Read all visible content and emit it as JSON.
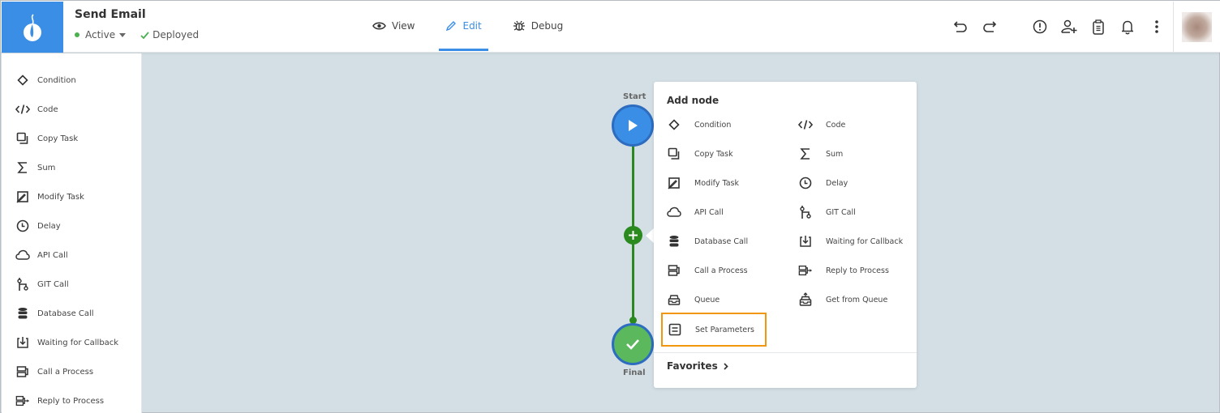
{
  "header": {
    "title": "Send Email",
    "status": "Active",
    "deploy_status": "Deployed",
    "colors": {
      "brand": "#3a8ee6",
      "active_dot": "#4caf50",
      "deployed_check": "#4caf50"
    }
  },
  "tabs": [
    {
      "label": "View",
      "icon": "eye-icon",
      "active": false
    },
    {
      "label": "Edit",
      "icon": "pencil-icon",
      "active": true
    },
    {
      "label": "Debug",
      "icon": "bug-icon",
      "active": false
    }
  ],
  "actions": [
    {
      "name": "undo",
      "icon": "undo-icon"
    },
    {
      "name": "redo",
      "icon": "redo-icon"
    },
    {
      "name": "alert",
      "icon": "alert-circle-icon"
    },
    {
      "name": "add-user",
      "icon": "user-plus-icon"
    },
    {
      "name": "clipboard",
      "icon": "clipboard-icon"
    },
    {
      "name": "notifications",
      "icon": "bell-icon"
    },
    {
      "name": "more",
      "icon": "more-vertical-icon"
    }
  ],
  "sidebar": {
    "items": [
      {
        "label": "Condition",
        "icon": "diamond-icon"
      },
      {
        "label": "Code",
        "icon": "code-icon"
      },
      {
        "label": "Copy Task",
        "icon": "copy-icon"
      },
      {
        "label": "Sum",
        "icon": "sigma-icon"
      },
      {
        "label": "Modify Task",
        "icon": "edit-box-icon"
      },
      {
        "label": "Delay",
        "icon": "clock-icon"
      },
      {
        "label": "API Call",
        "icon": "cloud-icon"
      },
      {
        "label": "GIT Call",
        "icon": "git-icon"
      },
      {
        "label": "Database Call",
        "icon": "database-icon"
      },
      {
        "label": "Waiting for Callback",
        "icon": "download-box-icon"
      },
      {
        "label": "Call a Process",
        "icon": "process-icon"
      },
      {
        "label": "Reply to Process",
        "icon": "reply-process-icon"
      }
    ]
  },
  "flow": {
    "start_label": "Start",
    "final_label": "Final",
    "colors": {
      "start": "#3a8ee6",
      "final": "#5cb85c",
      "line": "#2a8a1e"
    }
  },
  "popup": {
    "title": "Add node",
    "left_items": [
      {
        "label": "Condition",
        "icon": "diamond-icon"
      },
      {
        "label": "Copy Task",
        "icon": "copy-icon"
      },
      {
        "label": "Modify Task",
        "icon": "edit-box-icon"
      },
      {
        "label": "API Call",
        "icon": "cloud-icon"
      },
      {
        "label": "Database Call",
        "icon": "database-icon"
      },
      {
        "label": "Call a Process",
        "icon": "process-icon"
      },
      {
        "label": "Queue",
        "icon": "inbox-icon"
      },
      {
        "label": "Set Parameters",
        "icon": "list-box-icon",
        "highlighted": true
      }
    ],
    "right_items": [
      {
        "label": "Code",
        "icon": "code-icon"
      },
      {
        "label": "Sum",
        "icon": "sigma-icon"
      },
      {
        "label": "Delay",
        "icon": "clock-icon"
      },
      {
        "label": "GIT Call",
        "icon": "git-icon"
      },
      {
        "label": "Waiting for Callback",
        "icon": "download-box-icon"
      },
      {
        "label": "Reply to Process",
        "icon": "reply-process-icon"
      },
      {
        "label": "Get from Queue",
        "icon": "inbox-up-icon"
      }
    ],
    "favorites_label": "Favorites",
    "highlight_color": "#f2960d"
  }
}
